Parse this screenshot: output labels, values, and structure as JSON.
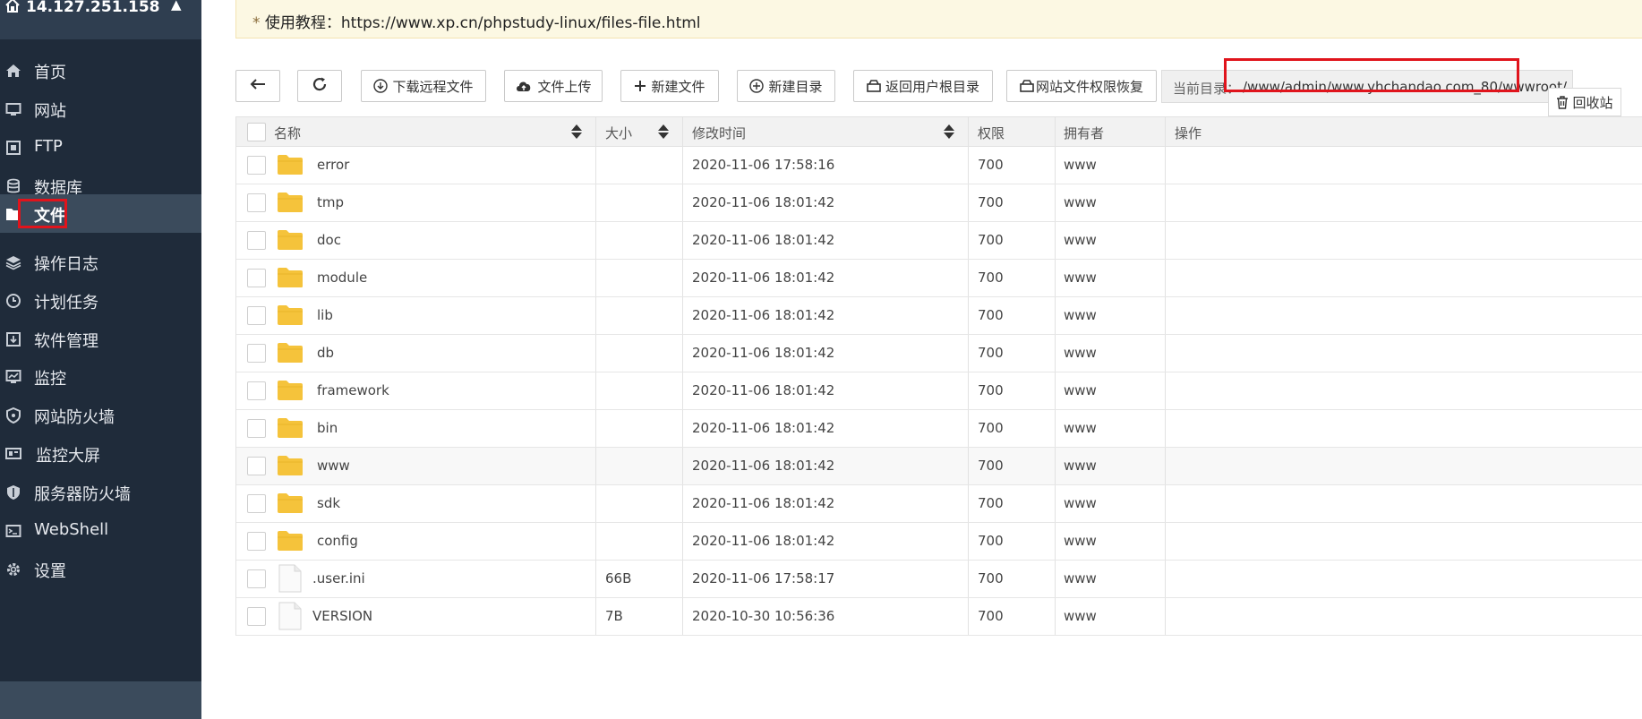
{
  "sidebar": {
    "host": "14.127.251.158",
    "items": [
      {
        "label": "首页"
      },
      {
        "label": "网站"
      },
      {
        "label": "FTP"
      },
      {
        "label": "数据库"
      },
      {
        "label": "文件"
      },
      {
        "label": "操作日志"
      },
      {
        "label": "计划任务"
      },
      {
        "label": "软件管理"
      },
      {
        "label": "监控"
      },
      {
        "label": "网站防火墙"
      },
      {
        "label": "监控大屏"
      },
      {
        "label": "服务器防火墙"
      },
      {
        "label": "WebShell"
      },
      {
        "label": "设置"
      }
    ],
    "active_index": 4
  },
  "tip": {
    "star": "*",
    "text": " 使用教程：https://www.xp.cn/phpstudy-linux/files-file.html"
  },
  "toolbar": {
    "download_remote": "下载远程文件",
    "upload": "文件上传",
    "new_file": "新建文件",
    "new_dir": "新建目录",
    "home_dir": "返回用户根目录",
    "restore_perms": "网站文件权限恢复",
    "current_dir_label": "当前目录：",
    "current_dir": "/www/admin/www.yhchandao.com_80/wwwroot/",
    "recycle": "回收站"
  },
  "table": {
    "columns": {
      "name": "名称",
      "size": "大小",
      "mtime": "修改时间",
      "perm": "权限",
      "owner": "拥有者",
      "action": "操作"
    },
    "rows": [
      {
        "type": "folder",
        "name": "error",
        "size": "",
        "mtime": "2020-11-06 17:58:16",
        "perm": "700",
        "owner": "www"
      },
      {
        "type": "folder",
        "name": "tmp",
        "size": "",
        "mtime": "2020-11-06 18:01:42",
        "perm": "700",
        "owner": "www"
      },
      {
        "type": "folder",
        "name": "doc",
        "size": "",
        "mtime": "2020-11-06 18:01:42",
        "perm": "700",
        "owner": "www"
      },
      {
        "type": "folder",
        "name": "module",
        "size": "",
        "mtime": "2020-11-06 18:01:42",
        "perm": "700",
        "owner": "www"
      },
      {
        "type": "folder",
        "name": "lib",
        "size": "",
        "mtime": "2020-11-06 18:01:42",
        "perm": "700",
        "owner": "www"
      },
      {
        "type": "folder",
        "name": "db",
        "size": "",
        "mtime": "2020-11-06 18:01:42",
        "perm": "700",
        "owner": "www"
      },
      {
        "type": "folder",
        "name": "framework",
        "size": "",
        "mtime": "2020-11-06 18:01:42",
        "perm": "700",
        "owner": "www"
      },
      {
        "type": "folder",
        "name": "bin",
        "size": "",
        "mtime": "2020-11-06 18:01:42",
        "perm": "700",
        "owner": "www"
      },
      {
        "type": "folder",
        "name": "www",
        "size": "",
        "mtime": "2020-11-06 18:01:42",
        "perm": "700",
        "owner": "www"
      },
      {
        "type": "folder",
        "name": "sdk",
        "size": "",
        "mtime": "2020-11-06 18:01:42",
        "perm": "700",
        "owner": "www"
      },
      {
        "type": "folder",
        "name": "config",
        "size": "",
        "mtime": "2020-11-06 18:01:42",
        "perm": "700",
        "owner": "www"
      },
      {
        "type": "file",
        "name": ".user.ini",
        "size": "66B",
        "mtime": "2020-11-06 17:58:17",
        "perm": "700",
        "owner": "www"
      },
      {
        "type": "file",
        "name": "VERSION",
        "size": "7B",
        "mtime": "2020-10-30 10:56:36",
        "perm": "700",
        "owner": "www"
      }
    ]
  },
  "colors": {
    "sidebar": "#1f2b3a",
    "sidebar_active": "#3b4b5c",
    "highlight": "#e0141c",
    "folder": "#f5c33b"
  }
}
